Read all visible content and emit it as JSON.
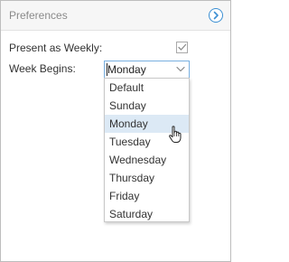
{
  "header": {
    "title": "Preferences",
    "collapse_icon": "chevron-right-circle-icon"
  },
  "settings": {
    "present_weekly_label": "Present as Weekly:",
    "present_weekly_checked": true,
    "week_begins_label": "Week Begins:",
    "week_begins_value": "Monday"
  },
  "dropdown": {
    "options": [
      "Default",
      "Sunday",
      "Monday",
      "Tuesday",
      "Wednesday",
      "Thursday",
      "Friday",
      "Saturday"
    ],
    "highlighted": "Monday"
  },
  "colors": {
    "accent": "#3b8fd3",
    "highlight": "#dce9f5",
    "border": "#bdbdbd"
  }
}
